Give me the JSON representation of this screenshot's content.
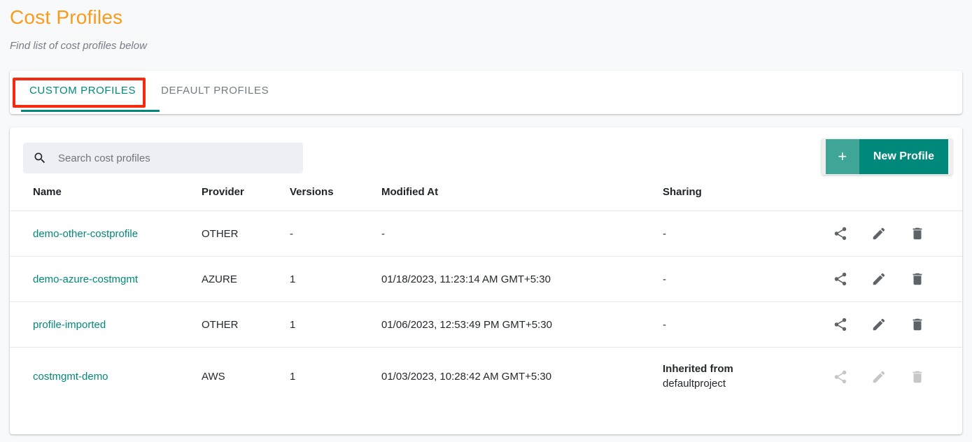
{
  "header": {
    "title": "Cost Profiles",
    "subtitle": "Find list of cost profiles below",
    "title_color": "#f99c1c"
  },
  "tabs": {
    "items": [
      {
        "label": "CUSTOM PROFILES",
        "active": true
      },
      {
        "label": "DEFAULT PROFILES",
        "active": false
      }
    ],
    "active_color": "#00897b",
    "inactive_color": "#757b84",
    "annotation_color": "#f42b0f"
  },
  "toolbar": {
    "search_placeholder": "Search cost profiles",
    "search_value": "",
    "search_icon": "search-icon",
    "new_profile_plus": "+",
    "new_profile_label": "New Profile",
    "button_color": "#00897b",
    "button_plus_color": "#3fa596"
  },
  "table": {
    "columns": [
      "Name",
      "Provider",
      "Versions",
      "Modified At",
      "Sharing"
    ],
    "rows": [
      {
        "name": "demo-other-costprofile",
        "provider": "OTHER",
        "versions": "-",
        "modified_at": "-",
        "sharing": "-",
        "sharing_sub": "",
        "actions_enabled": true
      },
      {
        "name": "demo-azure-costmgmt",
        "provider": "AZURE",
        "versions": "1",
        "modified_at": "01/18/2023, 11:23:14 AM GMT+5:30",
        "sharing": "-",
        "sharing_sub": "",
        "actions_enabled": true
      },
      {
        "name": "profile-imported",
        "provider": "OTHER",
        "versions": "1",
        "modified_at": "01/06/2023, 12:53:49 PM GMT+5:30",
        "sharing": "-",
        "sharing_sub": "",
        "actions_enabled": true
      },
      {
        "name": "costmgmt-demo",
        "provider": "AWS",
        "versions": "1",
        "modified_at": "01/03/2023, 10:28:42 AM GMT+5:30",
        "sharing": "Inherited from",
        "sharing_sub": "defaultproject",
        "actions_enabled": false
      }
    ],
    "action_icons": [
      "share-icon",
      "edit-icon",
      "delete-icon"
    ],
    "link_color": "#00897b"
  }
}
